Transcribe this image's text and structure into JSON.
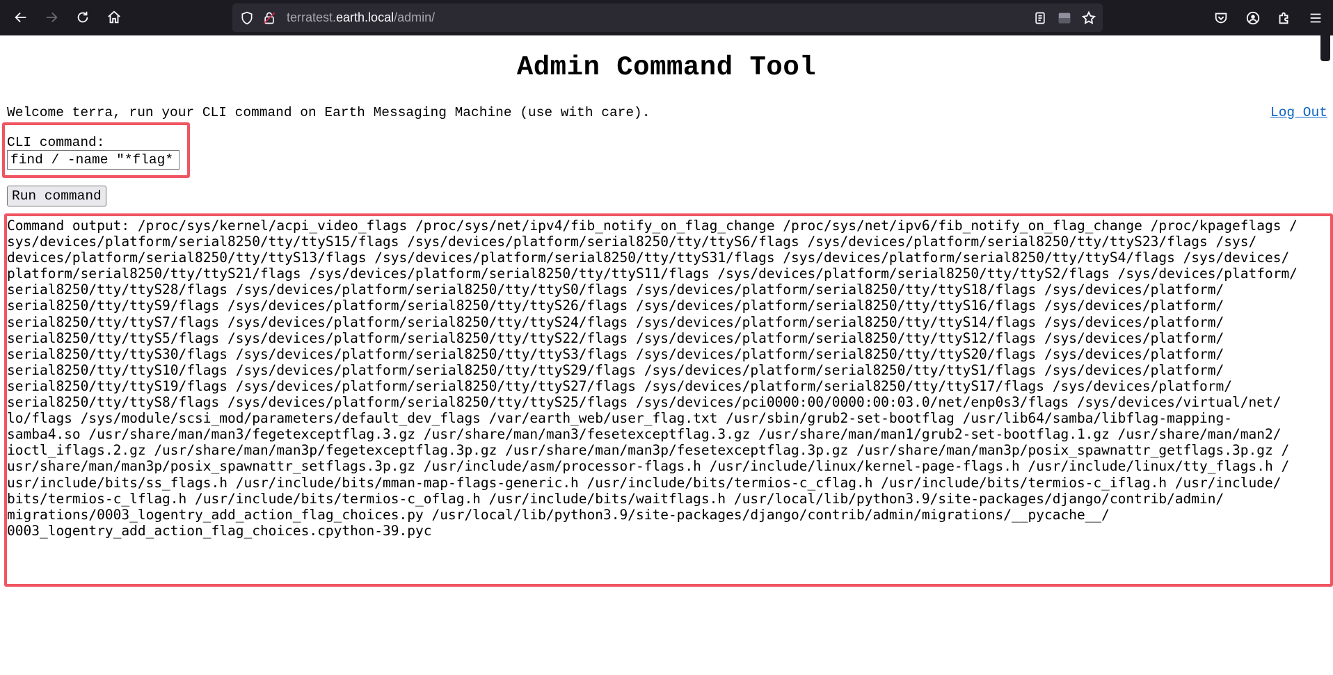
{
  "browser": {
    "url_prefix": "terratest.",
    "url_domain": "earth.local",
    "url_path": "/admin/",
    "icons": [
      "back-icon",
      "forward-icon",
      "reload-icon",
      "home-icon",
      "shield-icon",
      "lock-icon",
      "reader-icon",
      "extension-tray-icon",
      "bookmark-star-icon",
      "pocket-icon",
      "account-icon",
      "extensions-icon",
      "menu-icon"
    ]
  },
  "page": {
    "title": "Admin Command Tool",
    "welcome": "Welcome terra, run your CLI command on Earth Messaging Machine (use with care).",
    "logout": "Log Out",
    "cli_label": "CLI command:",
    "cli_value": "find / -name \"*flag*",
    "run_button": "Run command",
    "output_lines": [
      "Command output: /proc/sys/kernel/acpi_video_flags /proc/sys/net/ipv4/fib_notify_on_flag_change /proc/sys/net/ipv6/fib_notify_on_flag_change /proc/kpageflags /",
      "sys/devices/platform/serial8250/tty/ttyS15/flags /sys/devices/platform/serial8250/tty/ttyS6/flags /sys/devices/platform/serial8250/tty/ttyS23/flags /sys/",
      "devices/platform/serial8250/tty/ttyS13/flags /sys/devices/platform/serial8250/tty/ttyS31/flags /sys/devices/platform/serial8250/tty/ttyS4/flags /sys/devices/",
      "platform/serial8250/tty/ttyS21/flags /sys/devices/platform/serial8250/tty/ttyS11/flags /sys/devices/platform/serial8250/tty/ttyS2/flags /sys/devices/platform/",
      "serial8250/tty/ttyS28/flags /sys/devices/platform/serial8250/tty/ttyS0/flags /sys/devices/platform/serial8250/tty/ttyS18/flags /sys/devices/platform/",
      "serial8250/tty/ttyS9/flags /sys/devices/platform/serial8250/tty/ttyS26/flags /sys/devices/platform/serial8250/tty/ttyS16/flags /sys/devices/platform/",
      "serial8250/tty/ttyS7/flags /sys/devices/platform/serial8250/tty/ttyS24/flags /sys/devices/platform/serial8250/tty/ttyS14/flags /sys/devices/platform/",
      "serial8250/tty/ttyS5/flags /sys/devices/platform/serial8250/tty/ttyS22/flags /sys/devices/platform/serial8250/tty/ttyS12/flags /sys/devices/platform/",
      "serial8250/tty/ttyS30/flags /sys/devices/platform/serial8250/tty/ttyS3/flags /sys/devices/platform/serial8250/tty/ttyS20/flags /sys/devices/platform/",
      "serial8250/tty/ttyS10/flags /sys/devices/platform/serial8250/tty/ttyS29/flags /sys/devices/platform/serial8250/tty/ttyS1/flags /sys/devices/platform/",
      "serial8250/tty/ttyS19/flags /sys/devices/platform/serial8250/tty/ttyS27/flags /sys/devices/platform/serial8250/tty/ttyS17/flags /sys/devices/platform/",
      "serial8250/tty/ttyS8/flags /sys/devices/platform/serial8250/tty/ttyS25/flags /sys/devices/pci0000:00/0000:00:03.0/net/enp0s3/flags /sys/devices/virtual/net/",
      "lo/flags /sys/module/scsi_mod/parameters/default_dev_flags /var/earth_web/user_flag.txt /usr/sbin/grub2-set-bootflag /usr/lib64/samba/libflag-mapping-",
      "samba4.so /usr/share/man/man3/fegetexceptflag.3.gz /usr/share/man/man3/fesetexceptflag.3.gz /usr/share/man/man1/grub2-set-bootflag.1.gz /usr/share/man/man2/",
      "ioctl_iflags.2.gz /usr/share/man/man3p/fegetexceptflag.3p.gz /usr/share/man/man3p/fesetexceptflag.3p.gz /usr/share/man/man3p/posix_spawnattr_getflags.3p.gz /",
      "usr/share/man/man3p/posix_spawnattr_setflags.3p.gz /usr/include/asm/processor-flags.h /usr/include/linux/kernel-page-flags.h /usr/include/linux/tty_flags.h /",
      "usr/include/bits/ss_flags.h /usr/include/bits/mman-map-flags-generic.h /usr/include/bits/termios-c_cflag.h /usr/include/bits/termios-c_iflag.h /usr/include/",
      "bits/termios-c_lflag.h /usr/include/bits/termios-c_oflag.h /usr/include/bits/waitflags.h /usr/local/lib/python3.9/site-packages/django/contrib/admin/",
      "migrations/0003_logentry_add_action_flag_choices.py /usr/local/lib/python3.9/site-packages/django/contrib/admin/migrations/__pycache__/",
      "0003_logentry_add_action_flag_choices.cpython-39.pyc"
    ]
  },
  "colors": {
    "toolbar": "#1c1b22",
    "urlbar": "#2b2a33",
    "highlight": "#f05562",
    "link": "#0b63c4"
  }
}
